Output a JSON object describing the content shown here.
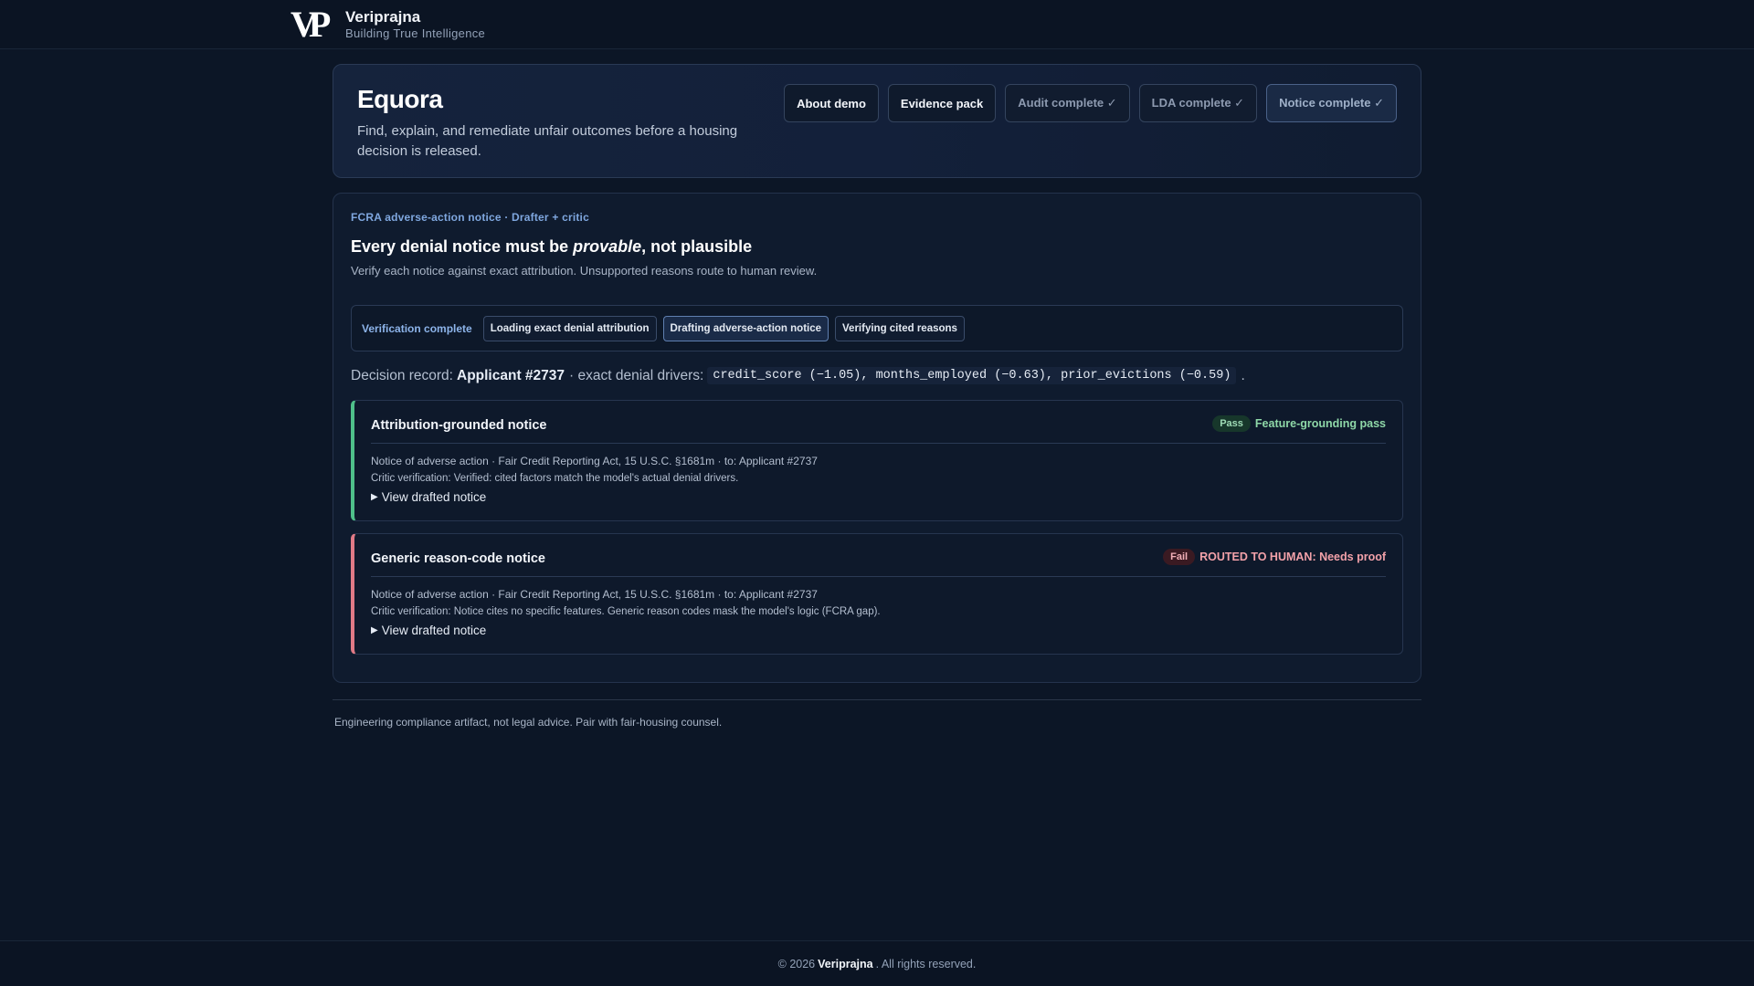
{
  "brand": {
    "logo": "VP",
    "name": "Veriprajna",
    "tagline": "Building True Intelligence"
  },
  "hero": {
    "title": "Equora",
    "description": "Find, explain, and remediate unfair outcomes before a housing decision is released.",
    "actions": [
      {
        "label": "About demo"
      },
      {
        "label": "Evidence pack"
      },
      {
        "label": "Audit complete ✓"
      },
      {
        "label": "LDA complete ✓"
      },
      {
        "label": "Notice complete ✓"
      }
    ]
  },
  "panel": {
    "eyebrow": "FCRA adverse-action notice · Drafter + critic",
    "heading_pre": "Every denial notice must be ",
    "heading_em": "provable",
    "heading_post": ", not plausible",
    "subline": "Verify each notice against exact attribution. Unsupported reasons route to human review.",
    "steps": {
      "status": "Verification complete",
      "items": [
        {
          "label": "Loading exact denial attribution"
        },
        {
          "label": "Drafting adverse-action notice"
        },
        {
          "label": "Verifying cited reasons"
        }
      ]
    },
    "record": {
      "prefix": "Decision record:",
      "applicant": "Applicant #2737",
      "middle": "· exact denial drivers:",
      "drivers": "credit_score (−1.05), months_employed (−0.63), prior_evictions (−0.59)",
      "suffix": "."
    },
    "cards": [
      {
        "title": "Attribution-grounded notice",
        "badge": "Pass",
        "verdict": "Feature-grounding pass",
        "meta": "Notice of adverse action · Fair Credit Reporting Act, 15 U.S.C. §1681m · to: Applicant #2737",
        "critic": "Critic verification: Verified: cited factors match the model's actual denial drivers.",
        "toggle": "View drafted notice"
      },
      {
        "title": "Generic reason-code notice",
        "badge": "Fail",
        "verdict": "ROUTED TO HUMAN: Needs proof",
        "meta": "Notice of adverse action · Fair Credit Reporting Act, 15 U.S.C. §1681m · to: Applicant #2737",
        "critic": "Critic verification: Notice cites no specific features. Generic reason codes mask the model's logic (FCRA gap).",
        "toggle": "View drafted notice"
      }
    ]
  },
  "footnote": "Engineering compliance artifact, not legal advice. Pair with fair-housing counsel.",
  "footer": {
    "prefix": "© 2026",
    "brand": "Veriprajna",
    "suffix": ". All rights reserved."
  },
  "colors": {
    "pass": "#4fc08a",
    "fail": "#e07a86",
    "accent": "#7fa7df"
  }
}
